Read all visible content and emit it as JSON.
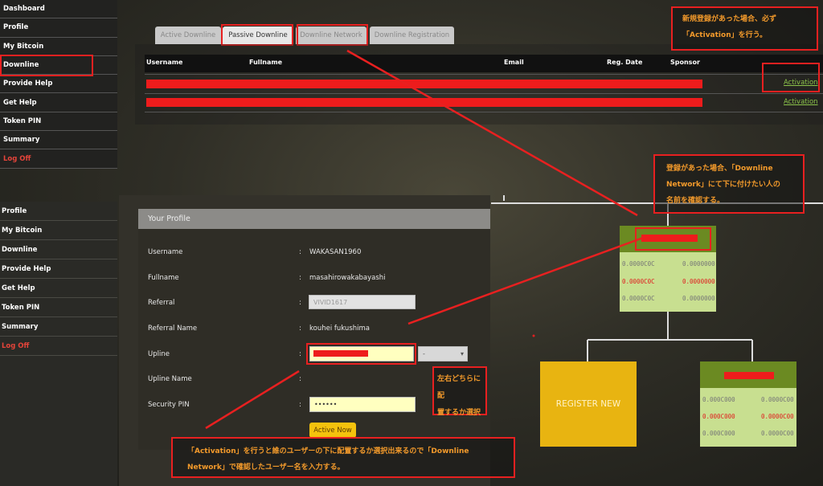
{
  "sidebar_top": {
    "items": [
      "Dashboard",
      "Profile",
      "My Bitcoin",
      "Downline",
      "Provide Help",
      "Get Help",
      "Token PIN",
      "Summary"
    ],
    "logoff": "Log Off"
  },
  "sidebar_bottom": {
    "items": [
      "Profile",
      "My Bitcoin",
      "Downline",
      "Provide Help",
      "Get Help",
      "Token PIN",
      "Summary"
    ],
    "logoff": "Log Off"
  },
  "tabs": [
    "Active Downline",
    "Passive Downline",
    "Downline Network",
    "Downline Registration"
  ],
  "table": {
    "headers": {
      "username": "Username",
      "fullname": "Fullname",
      "email": "Email",
      "reg_date": "Reg. Date",
      "sponsor": "Sponsor"
    },
    "rows": [
      {
        "action": "Activation"
      },
      {
        "action": "Activation"
      }
    ]
  },
  "notes": {
    "activation_line1": "新規登録があった場合、必ず",
    "activation_line2": "「Activation」を行う。",
    "network_line1": "登録があった場合、「Downline",
    "network_line2": "Network」にて下に付けたい人の",
    "network_line3": "名前を確認する。",
    "side_line1": "左右どちらに配",
    "side_line2": "置するか選択",
    "bottom_line1": "「Activation」を行うと誰のユーザーの下に配置するか選択出来るので「Downline",
    "bottom_line2": "Network」で確認したユーザー名を入力する。"
  },
  "profile": {
    "title": "Your Profile",
    "labels": {
      "username": "Username",
      "fullname": "Fullname",
      "referral": "Referral",
      "referral_name": "Referral Name",
      "upline": "Upline",
      "upline_name": "Upline Name",
      "security_pin": "Security PIN"
    },
    "colon": ":",
    "values": {
      "username": "WAKASAN1960",
      "fullname": "masahirowakabayashi",
      "referral": "VIVID1617",
      "referral_name": "kouhei fukushima",
      "side_select": "-",
      "security_pin": "••••••"
    },
    "button": "Active Now"
  },
  "tree": {
    "top_node": {
      "rows": [
        [
          "0.0000C0C",
          "0.0000000"
        ],
        [
          "0.0000C0C",
          "0.0000000"
        ],
        [
          "0.0000C0C",
          "0.0000000"
        ]
      ]
    },
    "register_label": "REGISTER NEW",
    "right_node": {
      "rows": [
        [
          "0.000C000",
          "0.0000C00"
        ],
        [
          "0.000C000",
          "0.0000C00"
        ],
        [
          "0.000C000",
          "0.0000C00"
        ]
      ]
    }
  },
  "colors": {
    "annotation": "#e82020",
    "note_text": "#f39a2b",
    "link": "#8bc34a",
    "node_bg": "#c8df90",
    "node_head": "#6b8a22",
    "register_bg": "#e8b411"
  }
}
